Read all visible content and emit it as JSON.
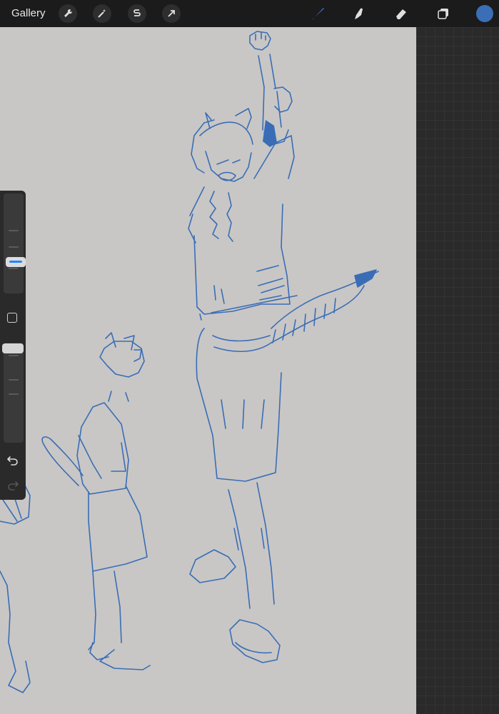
{
  "toolbar": {
    "gallery_label": "Gallery",
    "left_tools": [
      "wrench-icon",
      "magic-wand-icon",
      "selection-s-icon",
      "transform-arrow-icon"
    ],
    "right_tools": [
      "brush-icon",
      "smudge-icon",
      "eraser-icon",
      "layers-icon"
    ],
    "active_tool": "brush-icon",
    "current_color": "#3a6fb7",
    "active_tool_color": "#2f7bf5"
  },
  "sidebar": {
    "brush_size_level": 0.33,
    "opacity_level": 0.0,
    "items": [
      "brush-size-slider",
      "modify-button",
      "opacity-slider",
      "undo-button",
      "redo-button"
    ]
  },
  "canvas": {
    "background": "#c8c7c6",
    "stroke_color": "#3a6db5",
    "content": "blue-pencil-character-sketches"
  }
}
